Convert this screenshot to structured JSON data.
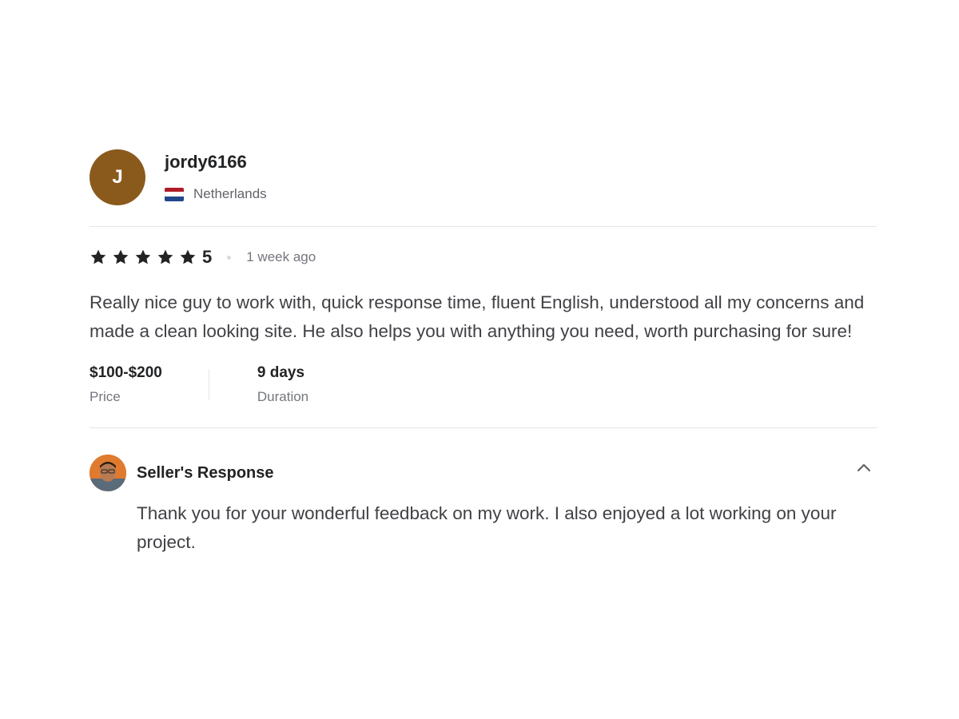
{
  "reviewer": {
    "initial": "J",
    "avatar_color": "#8a5a1d",
    "username": "jordy6166",
    "country": "Netherlands",
    "flag_colors": [
      "#ae1c28",
      "#ffffff",
      "#21468b"
    ]
  },
  "rating": {
    "stars": 5,
    "max_stars": 5,
    "value_label": "5",
    "star_icon": "star-icon",
    "time_ago": "1 week ago"
  },
  "review_text": "Really nice guy to work with, quick response time, fluent English, understood all my concerns and made a clean looking site. He also helps you with anything you need, worth purchasing for sure!",
  "meta": {
    "price_value": "$100-$200",
    "price_label": "Price",
    "duration_value": "9 days",
    "duration_label": "Duration"
  },
  "seller_response": {
    "title": "Seller's Response",
    "text": "Thank you for your wonderful feedback on my work. I also enjoyed a lot working on your project.",
    "toggle_icon": "chevron-up-icon"
  }
}
